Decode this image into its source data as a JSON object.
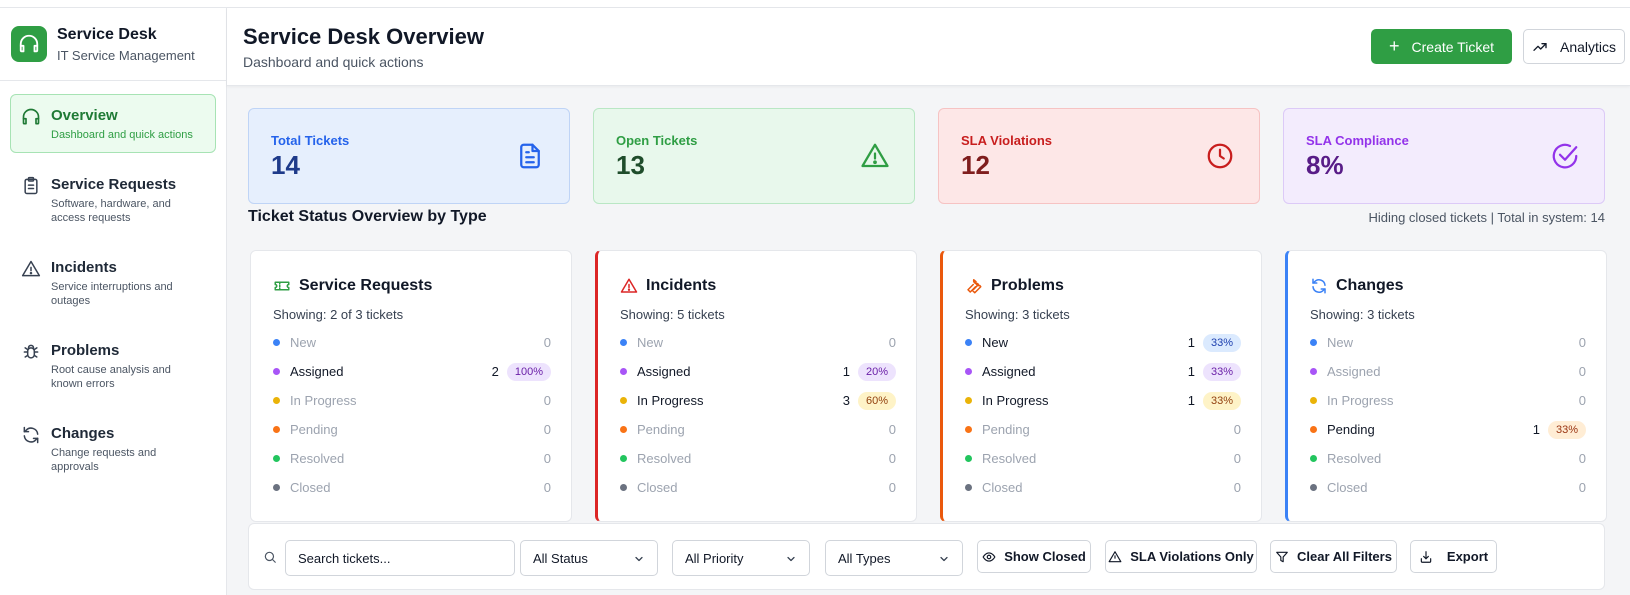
{
  "app": {
    "title": "Service Desk",
    "subtitle": "IT Service Management"
  },
  "sidebar": {
    "items": [
      {
        "label": "Overview",
        "desc": "Dashboard and quick actions",
        "icon": "headset-icon",
        "active": true
      },
      {
        "label": "Service Requests",
        "desc": "Software, hardware, and access requests",
        "icon": "clipboard-icon"
      },
      {
        "label": "Incidents",
        "desc": "Service interruptions and outages",
        "icon": "warning-icon"
      },
      {
        "label": "Problems",
        "desc": "Root cause analysis and known errors",
        "icon": "bug-icon"
      },
      {
        "label": "Changes",
        "desc": "Change requests and approvals",
        "icon": "refresh-icon"
      }
    ]
  },
  "header": {
    "title": "Service Desk Overview",
    "subtitle": "Dashboard and quick actions",
    "create_label": "Create Ticket",
    "analytics_label": "Analytics"
  },
  "stats": [
    {
      "label": "Total Tickets",
      "value": "14",
      "icon": "document-icon"
    },
    {
      "label": "Open Tickets",
      "value": "13",
      "icon": "warning-icon"
    },
    {
      "label": "SLA Violations",
      "value": "12",
      "icon": "clock-icon"
    },
    {
      "label": "SLA Compliance",
      "value": "8%",
      "icon": "check-circle-icon"
    }
  ],
  "section": {
    "title": "Ticket Status Overview by Type",
    "note": "Hiding closed tickets | Total in system: 14"
  },
  "type_cards": [
    {
      "title": "Service Requests",
      "showing": "Showing: 2 of 3 tickets",
      "icon": "ticket-icon",
      "rows": [
        {
          "label": "New",
          "count": "0",
          "pct": ""
        },
        {
          "label": "Assigned",
          "count": "2",
          "pct": "100%"
        },
        {
          "label": "In Progress",
          "count": "0",
          "pct": ""
        },
        {
          "label": "Pending",
          "count": "0",
          "pct": ""
        },
        {
          "label": "Resolved",
          "count": "0",
          "pct": ""
        },
        {
          "label": "Closed",
          "count": "0",
          "pct": ""
        }
      ]
    },
    {
      "title": "Incidents",
      "showing": "Showing: 5 tickets",
      "icon": "warning-icon",
      "rows": [
        {
          "label": "New",
          "count": "0",
          "pct": ""
        },
        {
          "label": "Assigned",
          "count": "1",
          "pct": "20%"
        },
        {
          "label": "In Progress",
          "count": "3",
          "pct": "60%"
        },
        {
          "label": "Pending",
          "count": "0",
          "pct": ""
        },
        {
          "label": "Resolved",
          "count": "0",
          "pct": ""
        },
        {
          "label": "Closed",
          "count": "0",
          "pct": ""
        }
      ]
    },
    {
      "title": "Problems",
      "showing": "Showing: 3 tickets",
      "icon": "wrench-icon",
      "rows": [
        {
          "label": "New",
          "count": "1",
          "pct": "33%"
        },
        {
          "label": "Assigned",
          "count": "1",
          "pct": "33%"
        },
        {
          "label": "In Progress",
          "count": "1",
          "pct": "33%"
        },
        {
          "label": "Pending",
          "count": "0",
          "pct": ""
        },
        {
          "label": "Resolved",
          "count": "0",
          "pct": ""
        },
        {
          "label": "Closed",
          "count": "0",
          "pct": ""
        }
      ]
    },
    {
      "title": "Changes",
      "showing": "Showing: 3 tickets",
      "icon": "refresh-icon",
      "rows": [
        {
          "label": "New",
          "count": "0",
          "pct": ""
        },
        {
          "label": "Assigned",
          "count": "0",
          "pct": ""
        },
        {
          "label": "In Progress",
          "count": "0",
          "pct": ""
        },
        {
          "label": "Pending",
          "count": "1",
          "pct": "33%"
        },
        {
          "label": "Resolved",
          "count": "0",
          "pct": ""
        },
        {
          "label": "Closed",
          "count": "0",
          "pct": ""
        }
      ]
    }
  ],
  "filters": {
    "search_placeholder": "Search tickets...",
    "status": "All Status",
    "priority": "All Priority",
    "types": "All Types",
    "show_closed": "Show Closed",
    "sla_only": "SLA Violations Only",
    "clear": "Clear All Filters",
    "export": "Export"
  }
}
